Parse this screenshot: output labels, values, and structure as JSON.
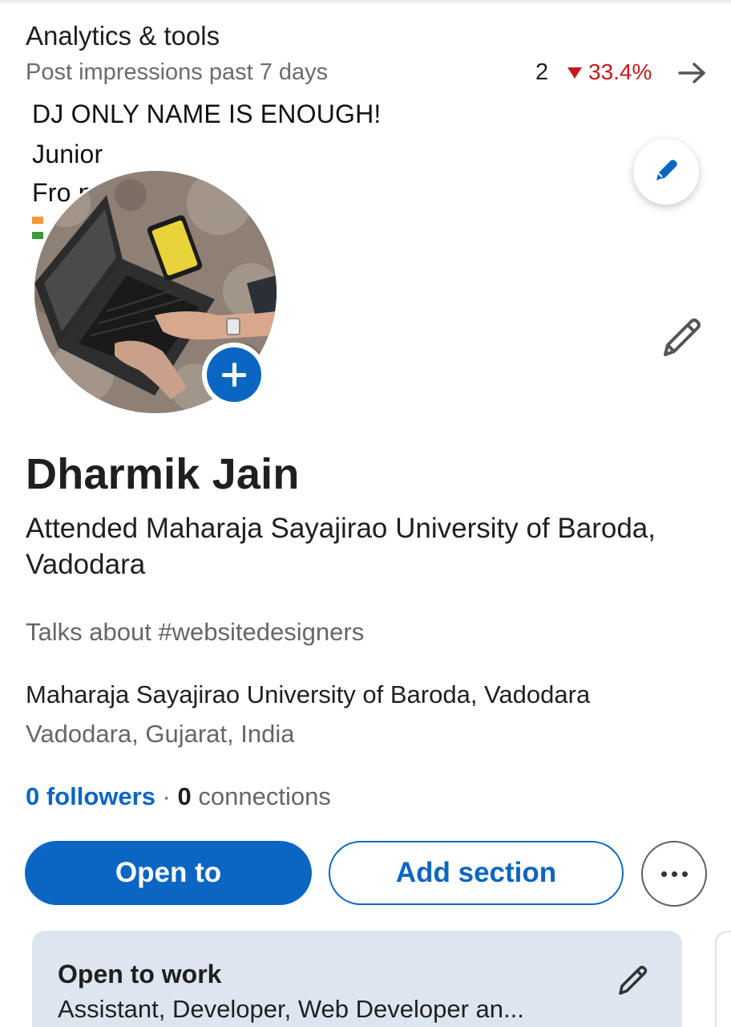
{
  "analytics": {
    "title": "Analytics & tools",
    "subtitle": "Post impressions past 7 days",
    "impressions": "2",
    "change": "33.4%",
    "change_direction": "down",
    "change_color": "#c5181a"
  },
  "banner": {
    "line1": "DJ ONLY NAME IS ENOUGH!",
    "line2": "Junior",
    "line3": "Fro                  per"
  },
  "profile": {
    "name": "Dharmik Jain",
    "headline": "Attended Maharaja Sayajirao University of Baroda, Vadodara",
    "talks_about": "Talks about #websitedesigners",
    "education": "Maharaja Sayajirao University of Baroda, Vadodara",
    "location": "Vadodara, Gujarat, India",
    "followers_label": "0 followers",
    "separator": " · ",
    "connections_count": "0",
    "connections_label": " connections"
  },
  "actions": {
    "open_to": "Open to",
    "add_section": "Add section",
    "more_icon": "more-horizontal-icon"
  },
  "open_to_work": {
    "title": "Open to work",
    "roles": "Assistant, Developer, Web Developer an..."
  },
  "colors": {
    "accent": "#0a66c2",
    "card_bg": "#dde6f0",
    "negative": "#c5181a"
  }
}
